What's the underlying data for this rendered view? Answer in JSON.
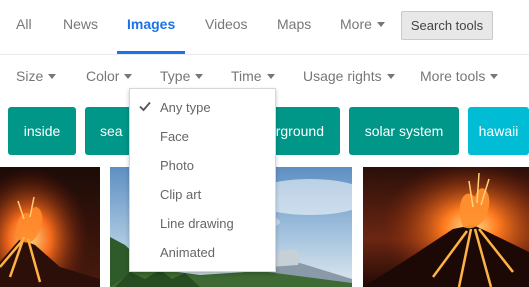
{
  "tabs": [
    {
      "label": "All"
    },
    {
      "label": "News"
    },
    {
      "label": "Images"
    },
    {
      "label": "Videos"
    },
    {
      "label": "Maps"
    },
    {
      "label": "More"
    }
  ],
  "search_tools_label": "Search tools",
  "filters": [
    {
      "label": "Size"
    },
    {
      "label": "Color"
    },
    {
      "label": "Type"
    },
    {
      "label": "Time"
    },
    {
      "label": "Usage rights"
    },
    {
      "label": "More tools"
    }
  ],
  "chips": [
    {
      "label": "inside",
      "color": "#009688"
    },
    {
      "label": "sea",
      "color": "#009688"
    },
    {
      "label": "underground",
      "color": "#009688"
    },
    {
      "label": "solar system",
      "color": "#009688"
    },
    {
      "label": "hawaii",
      "color": "#00bcd4"
    }
  ],
  "type_menu": {
    "selected": "Any type",
    "options": [
      "Any type",
      "Face",
      "Photo",
      "Clip art",
      "Line drawing",
      "Animated"
    ]
  },
  "colors": {
    "accent": "#1a73e8",
    "chip_teal": "#009688",
    "chip_cyan": "#00bcd4"
  }
}
